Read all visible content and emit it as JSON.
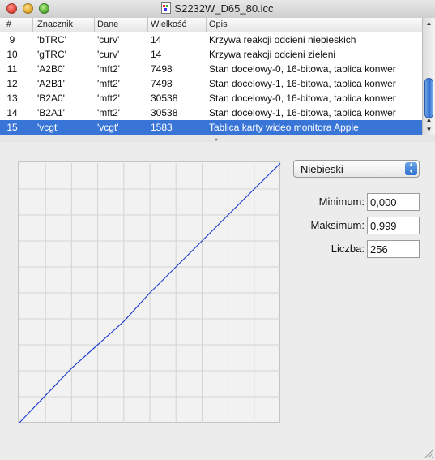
{
  "window": {
    "title": "S2232W_D65_80.icc"
  },
  "table": {
    "columns": [
      "#",
      "Znacznik",
      "Dane",
      "Wielkość",
      "Opis"
    ],
    "rows": [
      [
        "9",
        "'bTRC'",
        "'curv'",
        "14",
        "Krzywa reakcji odcieni niebieskich"
      ],
      [
        "10",
        "'gTRC'",
        "'curv'",
        "14",
        "Krzywa reakcji odcieni zieleni"
      ],
      [
        "11",
        "'A2B0'",
        "'mft2'",
        "7498",
        "Stan docelowy-0, 16-bitowa, tablica konwer"
      ],
      [
        "12",
        "'A2B1'",
        "'mft2'",
        "7498",
        "Stan docelowy-1, 16-bitowa, tablica konwer"
      ],
      [
        "13",
        "'B2A0'",
        "'mft2'",
        "30538",
        "Stan docelowy-0, 16-bitowa, tablica konwer"
      ],
      [
        "14",
        "'B2A1'",
        "'mft2'",
        "30538",
        "Stan docelowy-1, 16-bitowa, tablica konwer"
      ],
      [
        "15",
        "'vcgt'",
        "'vcgt'",
        "1583",
        "Tablica karty wideo monitora Apple"
      ]
    ],
    "selected_row": "15"
  },
  "channel_popup": {
    "value": "Niebieski"
  },
  "fields": {
    "minimum_label": "Minimum:",
    "minimum_value": "0,000",
    "maximum_label": "Maksimum:",
    "maximum_value": "0,999",
    "count_label": "Liczba:",
    "count_value": "256"
  },
  "chart_data": {
    "type": "line",
    "x": [
      0,
      0.1,
      0.2,
      0.3,
      0.4,
      0.5,
      0.6,
      0.7,
      0.8,
      0.9,
      1.0
    ],
    "series": [
      {
        "values": [
          0,
          0.105,
          0.21,
          0.3,
          0.39,
          0.5,
          0.6,
          0.7,
          0.8,
          0.9,
          0.999
        ]
      }
    ],
    "xlim": [
      0,
      1
    ],
    "ylim": [
      0,
      1
    ],
    "grid": true,
    "colors": {
      "line": "#2540d0",
      "grid": "#d4d4d4",
      "background": "#f2f2f2"
    }
  }
}
